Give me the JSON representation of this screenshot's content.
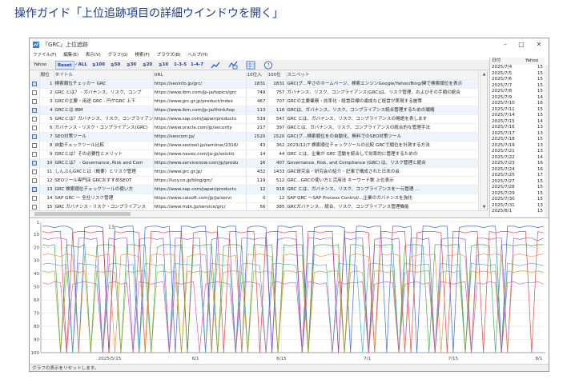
{
  "page": {
    "heading": "操作ガイド「上位追跡項目の詳細ウインドウを開く」"
  },
  "window": {
    "title": "「GRC」上位追跡",
    "controls": {
      "minimize": "–",
      "maximize": "□",
      "close": "✕"
    }
  },
  "menu": [
    "ファイル(F)",
    "編集(E)",
    "表示(V)",
    "グラフ(G)",
    "検索(F)",
    "ブラウズ(B)",
    "ヘルプ(H)"
  ],
  "toolbar": {
    "engine": "Yahoo",
    "reset": "Reset",
    "ranges": [
      "✓ALL",
      "≦100",
      "≦50",
      "≦30",
      "≦20",
      "≦10",
      "1-3-5",
      "1-4-7"
    ],
    "icons": [
      "line-chart-icon",
      "compare-icon",
      "table-view-icon",
      "help-icon"
    ]
  },
  "grid": {
    "columns": [
      "",
      "順位",
      "タイトル",
      "URL",
      "10位入",
      "100位",
      "スニペット"
    ],
    "rows": [
      {
        "checked": true,
        "rank": "1",
        "title": "検索順位チェッカー GRC",
        "url": "https://seoinfo.jp/grc/",
        "in10": "1831",
        "in100": "1831",
        "snippet": "GRC(グ...早さのホームページ、検索エンジンGoogle/Yahoo/Bing/関で検索順位を表示"
      },
      {
        "checked": false,
        "rank": "2",
        "title": "GRC とは？ - ガバナンス、リスク、コンプ",
        "url": "https://www.ibm.com/jp-ja/topics/grc",
        "in10": "749",
        "in100": "757",
        "snippet": "ガバナンス、リスク、コンプライアンス(GRC)は、リスク管理、およびその手順の統合"
      },
      {
        "checked": false,
        "rank": "3",
        "title": "GRCの主要・用途 GRC - 円ケGRC 上下",
        "url": "https://www.grc.gr.jp/product/index",
        "in10": "467",
        "in100": "707",
        "snippet": "GRCの主要業務・効率化・経営目標の達成など経営が実現する施策"
      },
      {
        "checked": true,
        "rank": "4",
        "title": "GRCとは IBM",
        "url": "https://www.ibm.com/jp-ja/think/top",
        "in10": "113",
        "in100": "116",
        "snippet": "GRCは、ガバナンス、リスク、コンプライアンス統合管理するための戦略"
      },
      {
        "checked": false,
        "rank": "5",
        "title": "GRCとは？ガバナンス、リスク、コンプライアンス",
        "url": "https://www.sap.com/japan/products",
        "in10": "519",
        "in100": "547",
        "snippet": "GRC とは、ガバナンス、リスク、コンプライアンスの略語を表します"
      },
      {
        "checked": false,
        "rank": "6",
        "title": "ガバナンス・リスク・コンプライアンス(GRC)",
        "url": "https://www.oracle.com/jp/security",
        "in10": "217",
        "in100": "397",
        "snippet": "GRCとは、ガバナンス、リスク、コンプライアンスの統合的な管理手法"
      },
      {
        "checked": true,
        "rank": "7",
        "title": "SEO対策ツール",
        "url": "https://seocom.jp/",
        "in10": "1520",
        "in100": "1520",
        "snippet": "GRC(グ...検索順位をの自動化、無料でのSEO対策ツール"
      },
      {
        "checked": false,
        "rank": "8",
        "title": "自動チェックツール比較",
        "url": "https://www.seotool.jp/seminar/2316/",
        "in10": "43",
        "in100": "362",
        "snippet": "2023/12/7 検索順位チェックツールの比較 GRCで順位を計測する方法"
      },
      {
        "checked": false,
        "rank": "9",
        "title": "GRCとは？その必要性とメリット",
        "url": "https://www.navex.com/ja-jp/solutio",
        "in10": "14",
        "in100": "44",
        "snippet": "GRC とは、企業が GRC 活動を統合して効率的に管理するための"
      },
      {
        "checked": true,
        "rank": "10",
        "title": "GRCとは？ - Governance, Risk and Com",
        "url": "https://www.servicenow.com/jp/produ",
        "in10": "16",
        "in100": "407",
        "snippet": "Governance, Risk, and Compliance (GRC) は、リスク管理と統合"
      },
      {
        "checked": false,
        "rank": "11",
        "title": "しんぶんGRCとは（概要）とリスク管理",
        "url": "https://www.grc.gr.jp/",
        "in10": "432",
        "in100": "1433",
        "snippet": "GRC研究会・研究会の紹介・記事で構成された日本の会"
      },
      {
        "checked": false,
        "rank": "12",
        "title": "SEOツール専門店 GRCおすすめSEOT",
        "url": "https://lucy.co.jp/blog/grc/",
        "in10": "119",
        "in100": "512",
        "snippet": "GRC...GRCの使い方と活用法 キーワード数 上位表示"
      },
      {
        "checked": true,
        "rank": "13",
        "title": "GRC 検索順位チェックツールの使い方",
        "url": "https://www.sap.com/japan/products",
        "in10": "12",
        "in100": "918",
        "snippet": "GRC とは、ガバナンス、リスク、コンプライアンスを一元管理 ..."
      },
      {
        "checked": false,
        "rank": "14",
        "title": "SAP GRC ～ 全社リスク管理",
        "url": "https://www.calsoft.com/jp/ja/servi",
        "in10": "0",
        "in100": "12",
        "snippet": "SAP GRC ～SAP Process Control/...企業のガバナンスを強化"
      },
      {
        "checked": false,
        "rank": "15",
        "title": "GRC ガバナンス・リスク・コンプライアンス",
        "url": "https://www.mdn.jp/service/grc/",
        "in10": "56",
        "in100": "385",
        "snippet": "GRCガバナンス... 統合、リスク、コンプライアンス管理機能"
      }
    ]
  },
  "side": {
    "columns": [
      "日付",
      "Yahoo"
    ],
    "rows": [
      [
        "2025/7/4",
        "15"
      ],
      [
        "2025/7/5",
        "15"
      ],
      [
        "2025/7/6",
        "15"
      ],
      [
        "2025/7/7",
        "15"
      ],
      [
        "2025/7/8",
        "15"
      ],
      [
        "2025/7/9",
        "14"
      ],
      [
        "2025/7/10",
        "16"
      ],
      [
        "2025/7/11",
        "15"
      ],
      [
        "2025/7/14",
        "15"
      ],
      [
        "2025/7/15",
        "14"
      ],
      [
        "2025/7/16",
        "13"
      ],
      [
        "2025/7/17",
        "13"
      ],
      [
        "2025/7/18",
        "15"
      ],
      [
        "2025/7/19",
        "13"
      ],
      [
        "2025/7/21",
        "13"
      ],
      [
        "2025/7/22",
        "14"
      ],
      [
        "2025/7/23",
        "16"
      ],
      [
        "2025/7/24",
        "16"
      ],
      [
        "2025/7/25",
        "17"
      ],
      [
        "2025/7/27",
        "15"
      ],
      [
        "2025/7/28",
        "15"
      ],
      [
        "2025/7/29",
        "15"
      ],
      [
        "2025/7/30",
        "15"
      ],
      [
        "2025/7/31",
        "13"
      ],
      [
        "2025/8/1",
        "15"
      ]
    ]
  },
  "status": "グラフの表示をリセットします。",
  "chart_data": {
    "type": "line",
    "title": "",
    "ylabel": "",
    "xlabel": "",
    "y_ticks": [
      "1",
      "10",
      "20",
      "30",
      "40",
      "50",
      "60",
      "70",
      "80",
      "90",
      "100"
    ],
    "x_ticks": [
      "2025/5/15",
      "6/1",
      "6/15",
      "7/1",
      "7/15",
      "8/1"
    ],
    "ylim": [
      1,
      100
    ],
    "inverted_y": true,
    "annotation": "13",
    "series": [
      {
        "color": "#1f4fd6",
        "values": [
          4,
          4,
          5,
          4,
          4,
          6,
          100,
          5,
          4,
          4,
          5,
          100,
          4,
          5,
          4,
          4,
          100,
          5,
          4,
          4,
          5,
          4,
          100,
          4,
          4,
          5,
          4,
          4,
          100,
          4,
          5,
          4,
          4,
          100,
          5,
          4,
          4,
          5,
          100,
          4,
          4,
          5,
          4,
          4,
          100,
          5,
          4,
          4,
          4,
          4,
          5,
          100,
          4,
          4,
          5,
          4,
          4,
          100,
          4,
          4,
          5,
          4,
          100,
          4,
          4,
          5,
          4,
          4,
          100,
          5,
          4,
          4,
          4,
          5,
          4,
          4,
          100,
          4,
          4,
          5,
          4,
          4,
          5,
          4
        ]
      },
      {
        "color": "#d62c2c",
        "values": [
          8,
          9,
          8,
          8,
          100,
          9,
          8,
          8,
          9,
          8,
          8,
          100,
          8,
          9,
          8,
          8,
          9,
          100,
          8,
          8,
          9,
          8,
          8,
          8,
          100,
          9,
          8,
          8,
          9,
          8,
          100,
          8,
          8,
          9,
          8,
          8,
          100,
          9,
          8,
          8,
          9,
          8,
          8,
          100,
          8,
          8,
          9,
          8,
          8,
          100,
          8,
          9,
          8,
          8,
          9,
          100,
          8,
          8,
          9,
          8,
          8,
          100,
          9,
          8,
          8,
          8,
          9,
          100,
          8,
          8,
          9,
          8,
          8,
          100,
          8,
          9,
          8,
          8,
          9,
          8,
          8,
          100,
          8,
          9
        ]
      },
      {
        "color": "#2a9a3a",
        "values": [
          18,
          19,
          18,
          100,
          18,
          19,
          20,
          18,
          100,
          19,
          18,
          18,
          19,
          100,
          18,
          18,
          19,
          18,
          100,
          20,
          18,
          18,
          19,
          18,
          100,
          18,
          19,
          18,
          18,
          100,
          19,
          18,
          18,
          19,
          100,
          18,
          18,
          19,
          18,
          100,
          18,
          19,
          18,
          18,
          100,
          19,
          18,
          18,
          19,
          18,
          100,
          18,
          18,
          19,
          100,
          18,
          19,
          18,
          18,
          100,
          19,
          18,
          18,
          19,
          100,
          18,
          18,
          19,
          18,
          18,
          100,
          19,
          18,
          18,
          19,
          100,
          18,
          18,
          19,
          18,
          18,
          19,
          18,
          18
        ]
      },
      {
        "color": "#8a3cc9",
        "values": [
          13,
          14,
          13,
          13,
          14,
          100,
          13,
          13,
          14,
          13,
          100,
          13,
          14,
          13,
          13,
          100,
          14,
          13,
          13,
          14,
          13,
          100,
          13,
          13,
          14,
          13,
          13,
          100,
          14,
          13,
          13,
          14,
          100,
          13,
          13,
          14,
          13,
          13,
          100,
          14,
          13,
          13,
          14,
          100,
          13,
          13,
          14,
          13,
          13,
          100,
          13,
          14,
          13,
          13,
          100,
          14,
          13,
          13,
          14,
          13,
          100,
          13,
          13,
          14,
          13,
          100,
          14,
          13,
          13,
          13,
          14,
          100,
          13,
          13,
          14,
          13,
          13,
          100,
          13,
          14,
          13,
          13,
          15,
          13
        ]
      },
      {
        "color": "#e0892a",
        "values": [
          26,
          25,
          26,
          27,
          25,
          26,
          100,
          25,
          26,
          27,
          26,
          25,
          100,
          26,
          25,
          26,
          27,
          100,
          26,
          25,
          26,
          25,
          26,
          100,
          27,
          26,
          25,
          26,
          100,
          25,
          26,
          27,
          26,
          100,
          25,
          26,
          25,
          26,
          27,
          100,
          26,
          25,
          26,
          26,
          100,
          25,
          27,
          26,
          25,
          26,
          100,
          26,
          25,
          26,
          27,
          100,
          25,
          26,
          25,
          26,
          100,
          27,
          26,
          25,
          26,
          25,
          100,
          26,
          26,
          25,
          27,
          100,
          26,
          25,
          26,
          25,
          26,
          100,
          26,
          25,
          26,
          27,
          26,
          25
        ]
      },
      {
        "color": "#20a8b8",
        "values": [
          33,
          32,
          33,
          34,
          33,
          100,
          32,
          33,
          33,
          34,
          100,
          33,
          32,
          33,
          34,
          33,
          100,
          32,
          33,
          34,
          33,
          100,
          32,
          33,
          33,
          34,
          33,
          100,
          32,
          33,
          34,
          33,
          100,
          33,
          32,
          33,
          34,
          100,
          33,
          32,
          33,
          33,
          34,
          100,
          32,
          33,
          34,
          33,
          100,
          32,
          33,
          33,
          34,
          100,
          33,
          32,
          33,
          34,
          33,
          100,
          32,
          33,
          34,
          33,
          33,
          100,
          32,
          33,
          34,
          33,
          100,
          32,
          33,
          33,
          34,
          33,
          100,
          32,
          33,
          34,
          33,
          32,
          33,
          34
        ]
      },
      {
        "color": "#9c9c20",
        "values": [
          38,
          39,
          38,
          100,
          39,
          38,
          39,
          38,
          100,
          38,
          39,
          38,
          39,
          100,
          38,
          39,
          38,
          38,
          100,
          39,
          38,
          39,
          38,
          100,
          38,
          39,
          38,
          39,
          38,
          100,
          39,
          38,
          38,
          39,
          100,
          38,
          39,
          38,
          39,
          100,
          38,
          38,
          39,
          38,
          100,
          39,
          38,
          39,
          38,
          38,
          100,
          39,
          38,
          39,
          100,
          38,
          38,
          39,
          38,
          100,
          39,
          38,
          39,
          38,
          38,
          100,
          39,
          38,
          39,
          38,
          100,
          38,
          39,
          38,
          39,
          38,
          100,
          38,
          39,
          38,
          38,
          39,
          38,
          39
        ]
      },
      {
        "color": "#c94f9c",
        "values": [
          47,
          48,
          46,
          47,
          100,
          48,
          47,
          46,
          47,
          48,
          100,
          47,
          46,
          48,
          47,
          100,
          46,
          47,
          48,
          47,
          46,
          100,
          47,
          48,
          47,
          46,
          100,
          48,
          47,
          46,
          47,
          48,
          100,
          47,
          46,
          47,
          48,
          100,
          47,
          46,
          48,
          47,
          47,
          100,
          46,
          47,
          48,
          47,
          100,
          46,
          48,
          47,
          47,
          46,
          100,
          48,
          47,
          46,
          47,
          100,
          48,
          47,
          46,
          48,
          47,
          100,
          46,
          47,
          48,
          47,
          46,
          100,
          47,
          48,
          46,
          47,
          100,
          47,
          46,
          48,
          47,
          47,
          46,
          48
        ]
      }
    ]
  }
}
